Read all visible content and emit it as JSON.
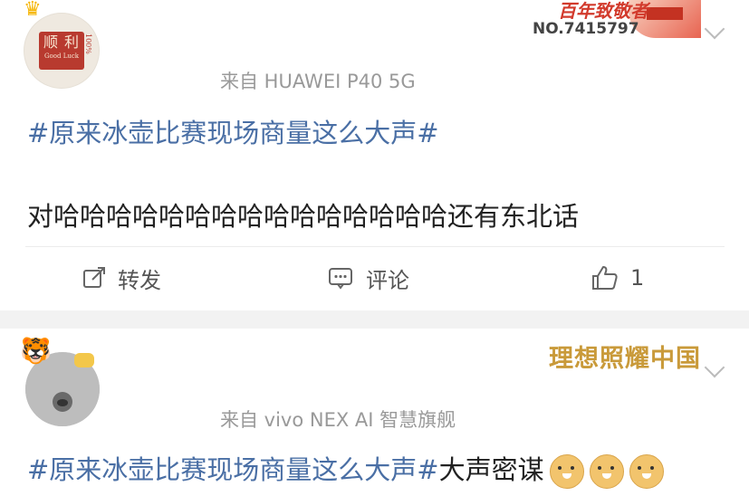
{
  "posts": [
    {
      "avatar_text": {
        "main": "顺 利",
        "sub": "Good Luck",
        "side": "100%"
      },
      "device": "来自 HUAWEI P40 5G",
      "badge": {
        "title": "百年致敬者",
        "number": "NO.7415797"
      },
      "topic": "#原来冰壶比赛现场商量这么大声#",
      "body": "对哈哈哈哈哈哈哈哈哈哈哈哈哈哈哈还有东北话",
      "actions": {
        "repost": "转发",
        "comment": "评论",
        "like_count": "1"
      }
    },
    {
      "device": "来自 vivo NEX AI 智慧旗舰",
      "badge": {
        "title": "理想照耀中国"
      },
      "topic": "#原来冰壶比赛现场商量这么大声#",
      "body": "大声密谋"
    }
  ],
  "icons": [
    "crown-icon",
    "chevron-down-icon",
    "repost-icon",
    "comment-icon",
    "like-icon",
    "doge-emoji",
    "tiger-icon"
  ],
  "colors": {
    "topic": "#4a6fa5",
    "muted": "#999999",
    "badge_gold": "#c99a3a",
    "badge_red": "#d23a2c"
  }
}
